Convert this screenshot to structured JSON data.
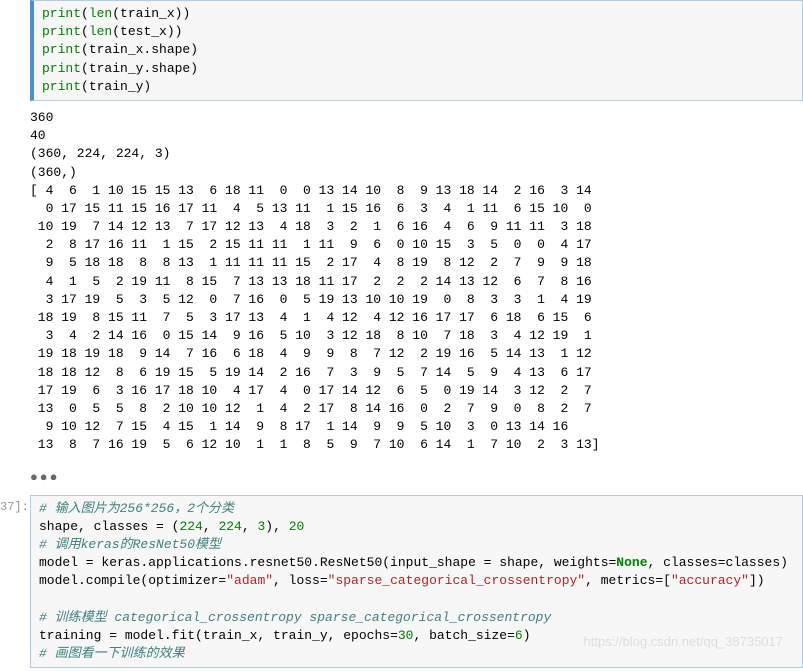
{
  "cell1": {
    "lines": {
      "l1_p1": "print",
      "l1_p2": "(",
      "l1_p3": "len",
      "l1_p4": "(train_x))",
      "l2_p1": "print",
      "l2_p2": "(",
      "l2_p3": "len",
      "l2_p4": "(test_x))",
      "l3_p1": "print",
      "l3_p2": "(train_x.shape)",
      "l4_p1": "print",
      "l4_p2": "(train_y.shape)",
      "l5_p1": "print",
      "l5_p2": "(train_y)"
    }
  },
  "output1": "360\n40\n(360, 224, 224, 3)\n(360,)\n[ 4  6  1 10 15 15 13  6 18 11  0  0 13 14 10  8  9 13 18 14  2 16  3 14\n  0 17 15 11 15 16 17 11  4  5 13 11  1 15 16  6  3  4  1 11  6 15 10  0\n 10 19  7 14 12 13  7 17 12 13  4 18  3  2  1  6 16  4  6  9 11 11  3 18\n  2  8 17 16 11  1 15  2 15 11 11  1 11  9  6  0 10 15  3  5  0  0  4 17\n  9  5 18 18  8  8 13  1 11 11 11 15  2 17  4  8 19  8 12  2  7  9  9 18\n  4  1  5  2 19 11  8 15  7 13 13 18 11 17  2  2  2 14 13 12  6  7  8 16\n  3 17 19  5  3  5 12  0  7 16  0  5 19 13 10 10 19  0  8  3  3  1  4 19\n 18 19  8 15 11  7  5  3 17 13  4  1  4 12  4 12 16 17 17  6 18  6 15  6\n  3  4  2 14 16  0 15 14  9 16  5 10  3 12 18  8 10  7 18  3  4 12 19  1\n 19 18 19 18  9 14  7 16  6 18  4  9  9  8  7 12  2 19 16  5 14 13  1 12\n 18 18 12  8  6 19 15  5 19 14  2 16  7  3  9  5  7 14  5  9  4 13  6 17\n 17 19  6  3 16 17 18 10  4 17  4  0 17 14 12  6  5  0 19 14  3 12  2  7\n 13  0  5  5  8  2 10 10 12  1  4  2 17  8 14 16  0  2  7  9  0  8  2  7\n  9 10 12  7 15  4 15  1 14  9  8 17  1 14  9  9  5 10  3  0 13 14 16\n 13  8  7 16 19  5  6 12 10  1  1  8  5  9  7 10  6 14  1  7 10  2  3 13]",
  "ellipsis": "●●●",
  "prompt2": "37]:",
  "cell2": {
    "c1": "# 输入图片为256*256，2个分类",
    "l2_p1": "shape, classes = (",
    "l2_n1": "224",
    "l2_c1": ", ",
    "l2_n2": "224",
    "l2_c2": ", ",
    "l2_n3": "3",
    "l2_c3": "), ",
    "l2_n4": "20",
    "c2": "# 调用keras的ResNet50模型",
    "l4_p1": "model = keras.applications.resnet50.ResNet50(input_shape = shape, weights=",
    "l4_none": "None",
    "l4_p2": ", classes=classes)",
    "l5_p1": "model.compile(optimizer=",
    "l5_s1": "\"adam\"",
    "l5_p2": ", loss=",
    "l5_s2": "\"sparse_categorical_crossentropy\"",
    "l5_p3": ", metrics=[",
    "l5_s3": "\"accuracy\"",
    "l5_p4": "])",
    "blank": "",
    "c3": "# 训练模型 categorical_crossentropy sparse_categorical_crossentropy",
    "l8_p1": "training = model.fit(train_x, train_y, epochs=",
    "l8_n1": "30",
    "l8_p2": ", batch_size=",
    "l8_n2": "6",
    "l8_p3": ")",
    "c4": "# 画图看一下训练的效果"
  },
  "watermark": "https://blog.csdn.net/qq_38735017"
}
